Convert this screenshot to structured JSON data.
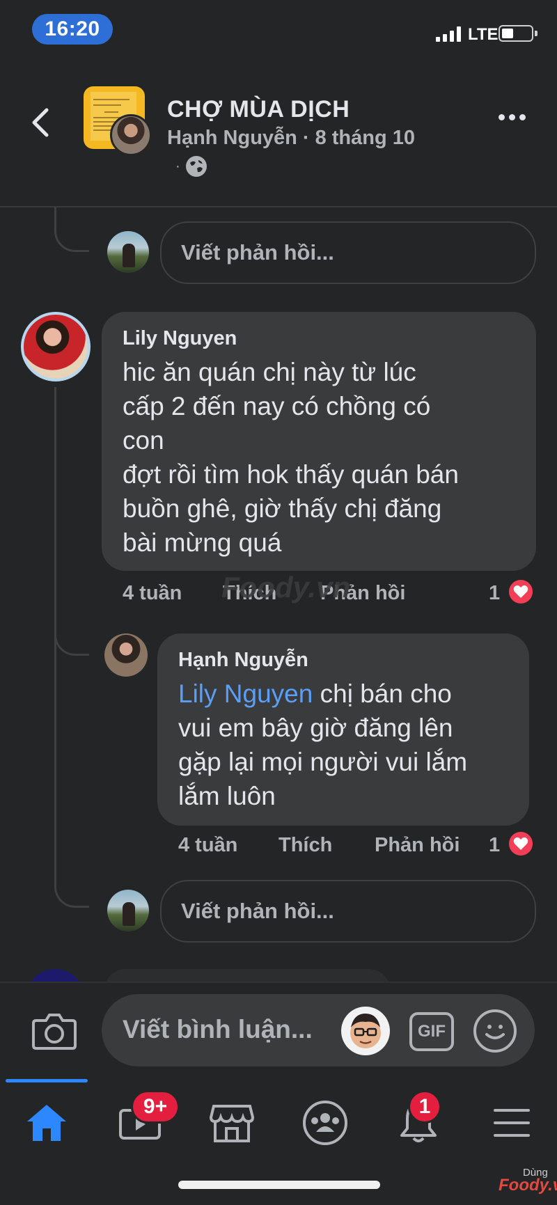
{
  "status_bar": {
    "time": "16:20",
    "network": "LTE"
  },
  "header": {
    "group_name": "CHỢ MÙA DỊCH",
    "poster_name": "Hạnh Nguyễn",
    "separator": "·",
    "post_date": "8 tháng 10",
    "privacy_dot": "·",
    "privacy_icon": "globe-icon"
  },
  "thread": {
    "reply_placeholder": "Viết phản hồi...",
    "comments": [
      {
        "author": "Lily Nguyen",
        "lines": [
          "hic ăn quán chị này từ lúc",
          "cấp 2 đến nay có chồng có",
          "con",
          "đợt rồi tìm hok thấy quán bán",
          "buồn ghê, giờ thấy chị đăng",
          "bài mừng quá"
        ],
        "age": "4 tuần",
        "like_label": "Thích",
        "reply_label": "Phản hồi",
        "reaction_count": "1",
        "reaction": "heart-icon"
      },
      {
        "author": "Hạnh Nguyễn",
        "mention": "Lily Nguyen",
        "first_line_rest": " chị bán cho",
        "lines": [
          "vui em bây giờ đăng lên",
          "gặp lại mọi người vui lắm",
          "lắm luôn"
        ],
        "age": "4 tuần",
        "like_label": "Thích",
        "reply_label": "Phản hồi",
        "reaction_count": "1",
        "reaction": "heart-icon"
      }
    ]
  },
  "watermark": "Foody.vn",
  "composer": {
    "placeholder": "Viết bình luận...",
    "gif_label": "GIF"
  },
  "tabbar": {
    "video_badge": "9+",
    "notification_badge": "1",
    "accent": "#2d88ff"
  },
  "corner_mark": {
    "top": "Dùng",
    "brand": "Foody.vn"
  }
}
